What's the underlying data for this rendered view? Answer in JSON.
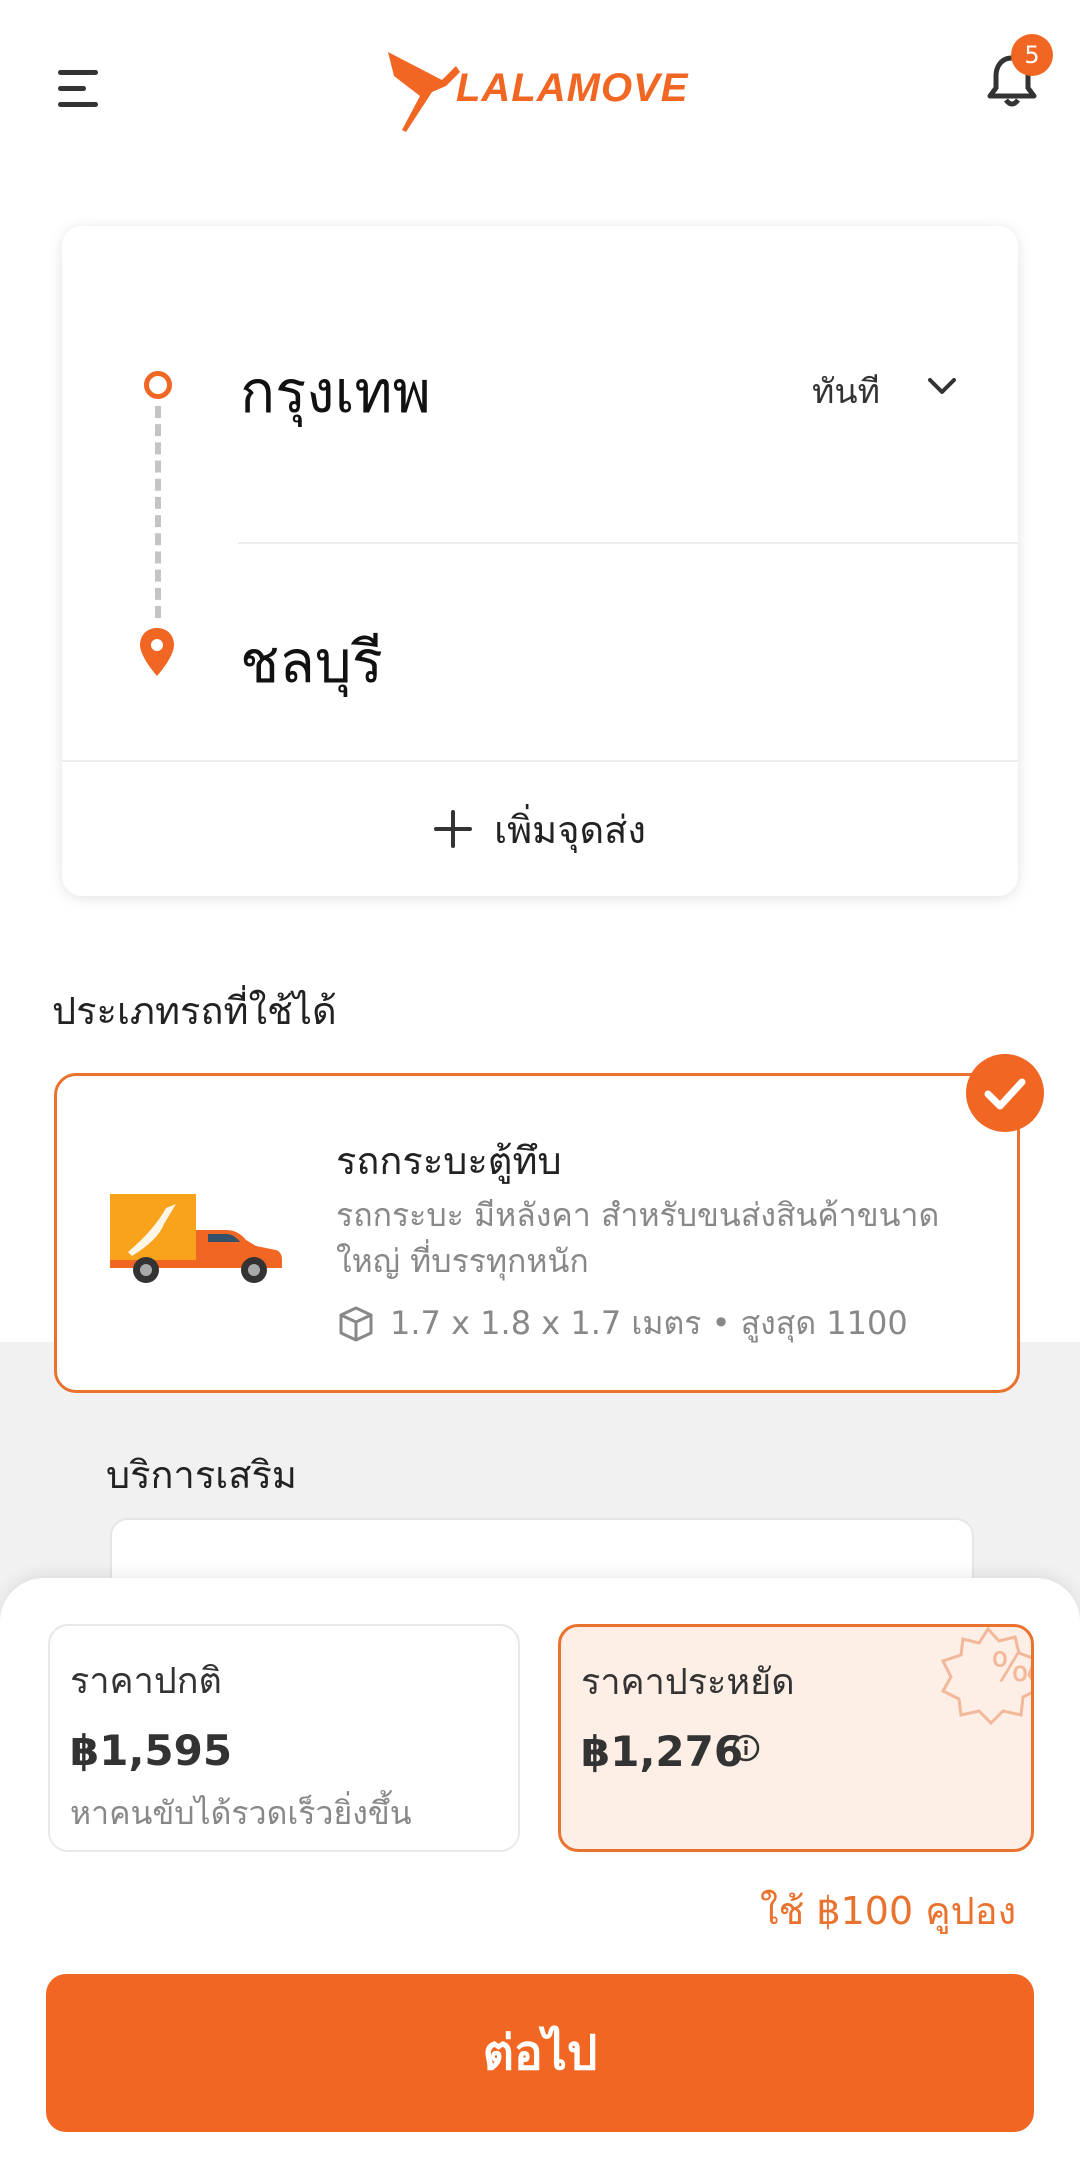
{
  "header": {
    "brand": "LALAMOVE",
    "notification_count": "5"
  },
  "route": {
    "pickup": "กรุงเทพ",
    "dropoff": "ชลบุรี",
    "time": "ทันที",
    "add_stop": "เพิ่มจุดส่ง"
  },
  "vehicles": {
    "section_title": "ประเภทรถที่ใช้ได้",
    "selected": {
      "name": "รถกระบะตู้ทึบ",
      "description": "รถกระบะ มีหลังคา สำหรับขนส่งสินค้าขนาดใหญ่ ที่บรรทุกหนัก",
      "spec": "1.7 x 1.8 x 1.7 เมตร • สูงสุด 1100"
    }
  },
  "extras": {
    "title": "บริการเสริม"
  },
  "pricing": {
    "normal": {
      "title": "ราคาปกติ",
      "value": "฿1,595",
      "subtitle": "หาคนขับได้รวดเร็วยิ่งขึ้น"
    },
    "saver": {
      "title": "ราคาประหยัด",
      "value": "฿1,276"
    },
    "coupon": "ใช้ ฿100 คูปอง"
  },
  "actions": {
    "next": "ต่อไป"
  },
  "colors": {
    "accent": "#F16622",
    "accent_light": "#fdeee6"
  }
}
